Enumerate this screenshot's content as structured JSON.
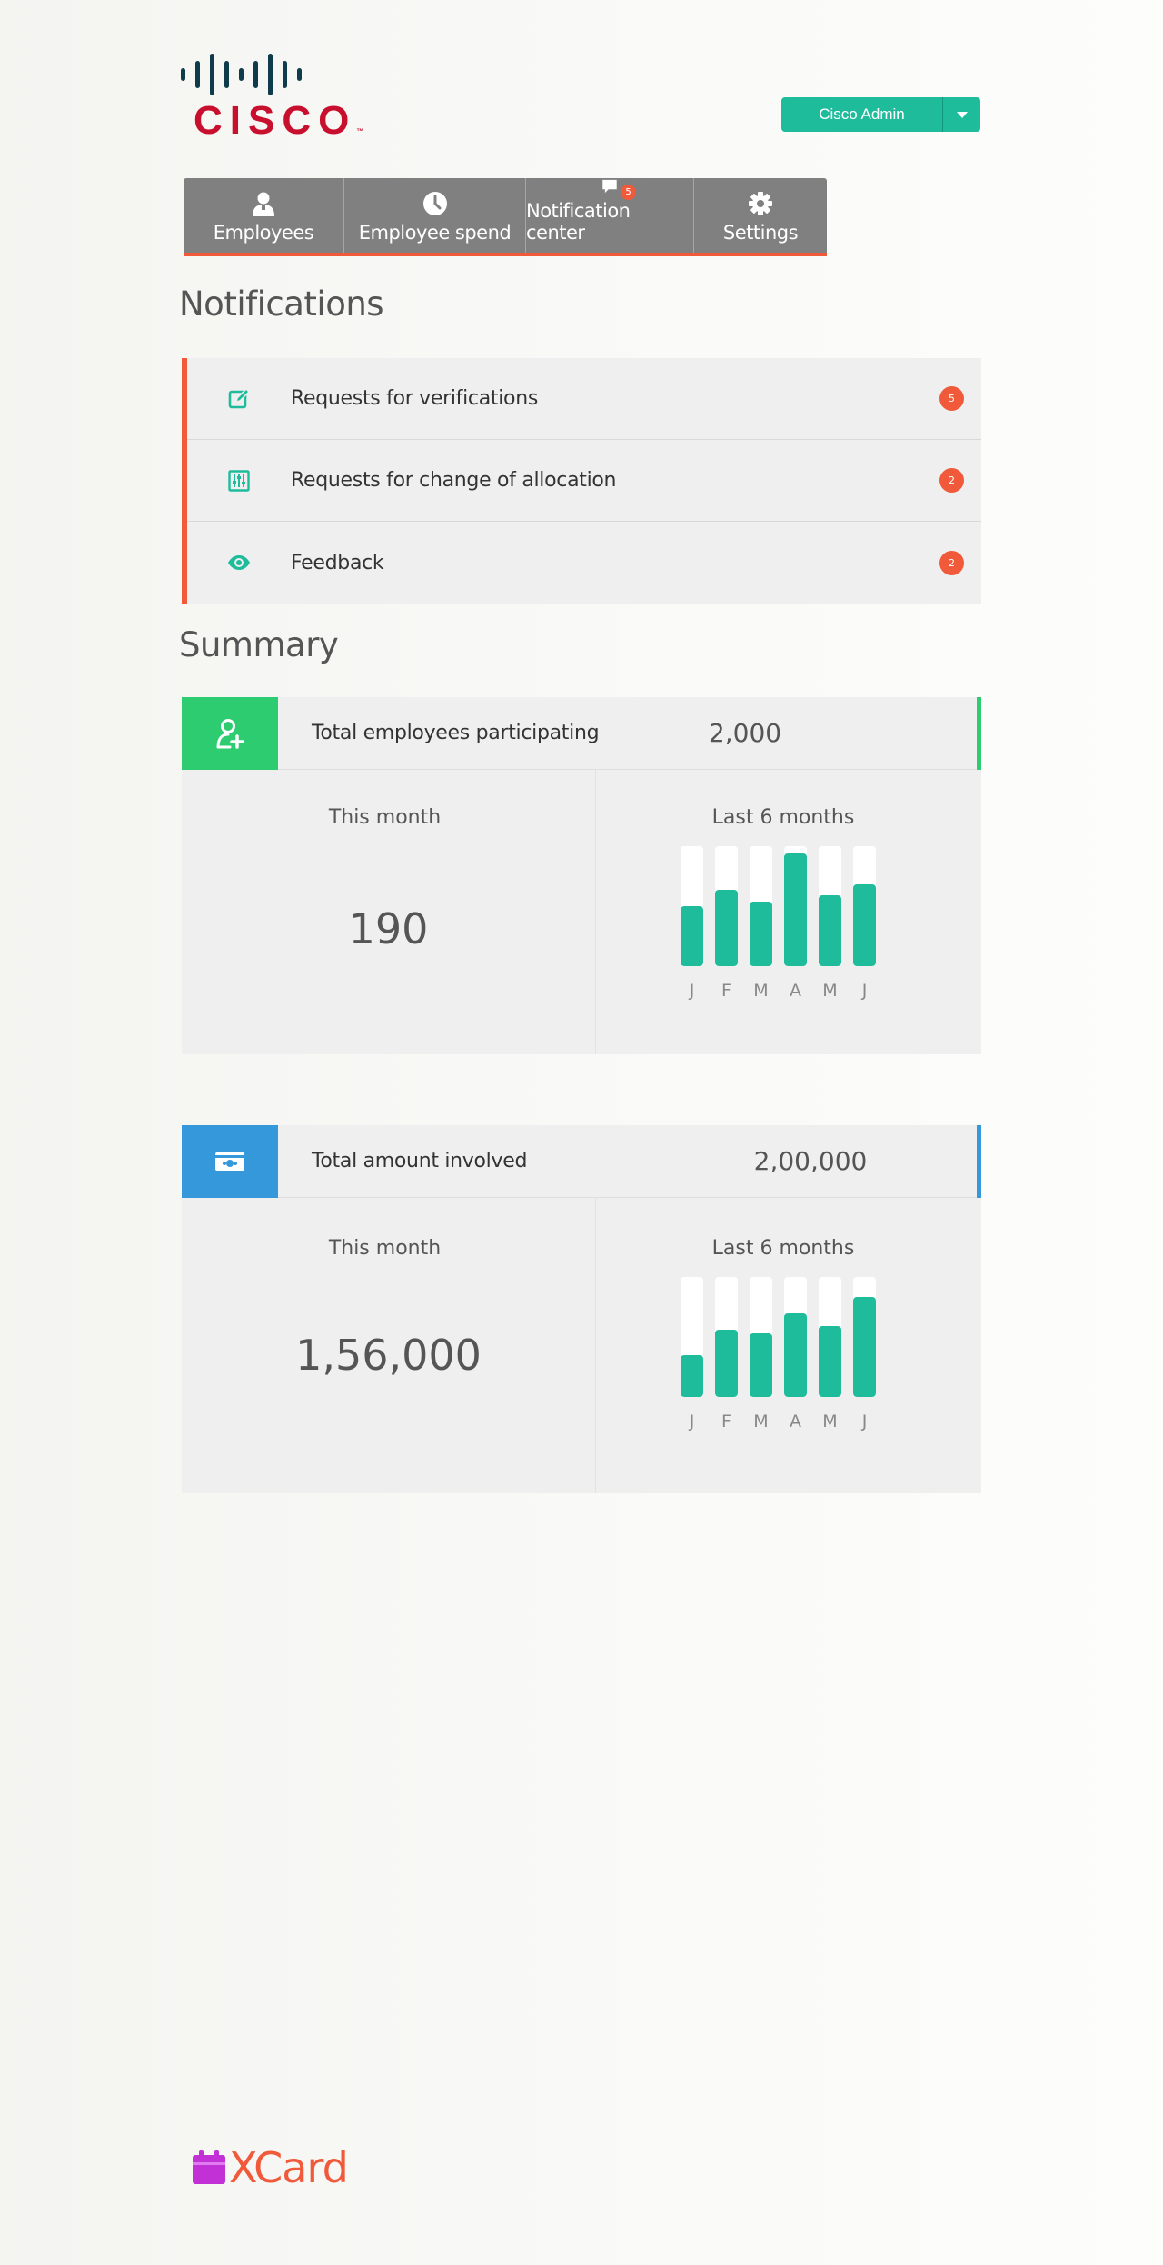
{
  "header": {
    "logo_text": "CISCO",
    "logo_tm": "™",
    "admin_label": "Cisco Admin"
  },
  "nav": {
    "tabs": [
      {
        "label": "Employees",
        "icon": "person-icon"
      },
      {
        "label": "Employee spend",
        "icon": "clock-icon"
      },
      {
        "label": "Notification center",
        "icon": "chat-icon",
        "badge": "5"
      },
      {
        "label": "Settings",
        "icon": "gear-icon"
      }
    ]
  },
  "notifications": {
    "title": "Notifications",
    "items": [
      {
        "label": "Requests for verifications",
        "count": "5",
        "icon": "edit-icon"
      },
      {
        "label": "Requests for change of allocation",
        "count": "2",
        "icon": "sliders-icon"
      },
      {
        "label": "Feedback",
        "count": "2",
        "icon": "eye-icon"
      }
    ]
  },
  "summary": {
    "title": "Summary",
    "cards": [
      {
        "label": "Total employees participating",
        "total": "2,000",
        "this_month_caption": "This month",
        "this_month_value": "190",
        "last_caption": "Last  6 months",
        "icon": "add-user-icon",
        "accent_color": "#2ecc71",
        "icon_bg": "#2ecc71",
        "bars": [
          {
            "label": "J",
            "level": 0.5
          },
          {
            "label": "F",
            "level": 0.64
          },
          {
            "label": "M",
            "level": 0.54
          },
          {
            "label": "A",
            "level": 0.94
          },
          {
            "label": "M",
            "level": 0.59
          },
          {
            "label": "J",
            "level": 0.68
          }
        ]
      },
      {
        "label": "Total amount involved",
        "total": "2,00,000",
        "this_month_caption": "This month",
        "this_month_value": "1,56,000",
        "last_caption": "Last  6 months",
        "icon": "money-icon",
        "accent_color": "#3498db",
        "icon_bg": "#3498db",
        "bars": [
          {
            "label": "J",
            "level": 0.35
          },
          {
            "label": "F",
            "level": 0.56
          },
          {
            "label": "M",
            "level": 0.53
          },
          {
            "label": "A",
            "level": 0.7
          },
          {
            "label": "M",
            "level": 0.59
          },
          {
            "label": "J",
            "level": 0.83
          }
        ]
      }
    ]
  },
  "footer": {
    "brand": "XCard"
  }
}
